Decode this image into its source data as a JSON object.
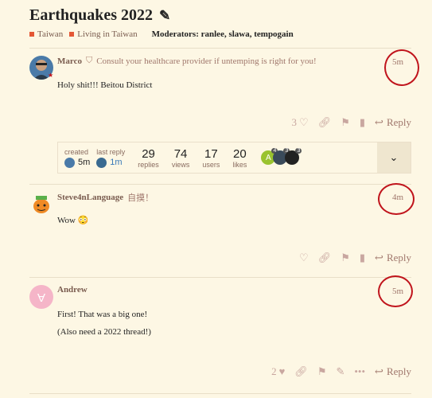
{
  "topic": {
    "title": "Earthquakes 2022",
    "edit_icon": "pencil-icon",
    "categories": [
      {
        "label": "Taiwan",
        "color": "#e45735"
      },
      {
        "label": "Living in Taiwan",
        "color": "#e45735"
      }
    ],
    "moderators": "Moderators: ranlee, slawa, tempogain"
  },
  "posts": [
    {
      "author": "Marco",
      "flair_icon": "shield-icon",
      "user_title": "Consult your healthcare provider if untemping is right for you!",
      "time": "5m",
      "body": [
        "Holy shit!!! Beitou District"
      ],
      "like_count": "3",
      "reply_label": "Reply"
    },
    {
      "author": "Steve4nLanguage",
      "user_title": "自摸！",
      "time": "4m",
      "body": [
        "Wow 😳"
      ],
      "like_count": "",
      "reply_label": "Reply"
    },
    {
      "author": "Andrew",
      "avatar_letter": "A",
      "time": "5m",
      "body": [
        "First! That was a big one!",
        "(Also need a 2022 thread!)"
      ],
      "like_count": "2",
      "reply_label": "Reply"
    }
  ],
  "topic_map": {
    "created_label": "created",
    "created_time": "5m",
    "last_reply_label": "last reply",
    "last_reply_time": "1m",
    "stats": [
      {
        "value": "29",
        "label": "replies"
      },
      {
        "value": "74",
        "label": "views"
      },
      {
        "value": "17",
        "label": "users"
      },
      {
        "value": "20",
        "label": "likes"
      }
    ],
    "participants": [
      {
        "letter": "A",
        "count": "4",
        "color": "#9ac32f"
      },
      {
        "letter": "",
        "count": "3",
        "color": "#3a4a5a"
      },
      {
        "letter": "",
        "count": "3",
        "color": "#222222"
      }
    ],
    "toggle_icon": "chevron-down-icon"
  },
  "colors": {
    "background": "#fdf7e4",
    "category": "#e45735",
    "annotation_circle": "#c0141c",
    "muted": "#a0776c"
  }
}
